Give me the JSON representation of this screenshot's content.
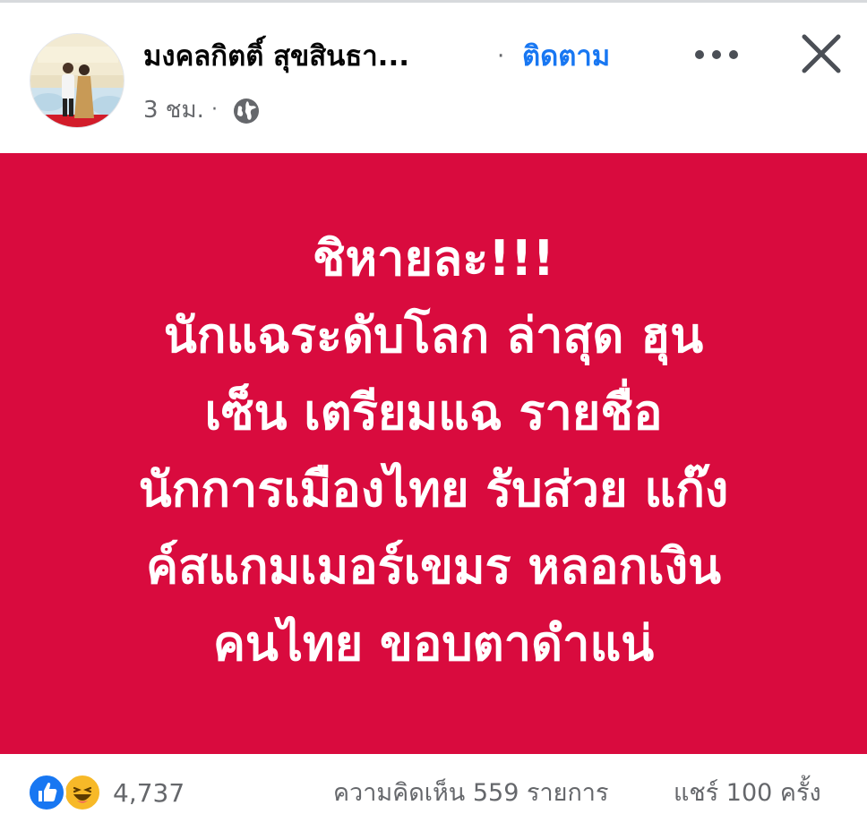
{
  "post": {
    "author_name": "มงคลกิตติ์ สุขสินธา...",
    "separator": "·",
    "follow_label": "ติดตาม",
    "timestamp": "3 ชม.",
    "time_separator": "·",
    "privacy_icon": "globe-icon",
    "more_icon": "more-options-icon",
    "close_icon": "close-icon",
    "background_color": "#d90b3e",
    "text": "ชิหายละ!!!\nนักแฉระดับโลก ล่าสุด ฮุน\nเซ็น เตรียมแฉ รายชื่อ\nนักการเมืองไทย รับส่วย แก๊ง\nค์สแกมเมอร์เขมร หลอกเงิน\nคนไทย ขอบตาดำแน่"
  },
  "stats": {
    "reaction_icons": [
      "like-icon",
      "haha-icon"
    ],
    "reaction_count": "4,737",
    "comments": "ความคิดเห็น 559 รายการ",
    "shares": "แชร์ 100 ครั้ง"
  },
  "colors": {
    "accent": "#1877f2",
    "secondary_text": "#65676b"
  }
}
